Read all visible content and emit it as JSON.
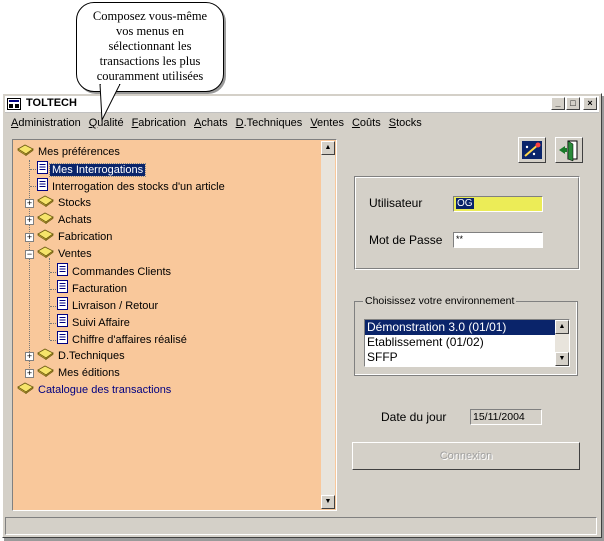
{
  "callout": {
    "text": "Composez vous-même vos menus en sélectionnant les transactions les plus couramment utilisées"
  },
  "window": {
    "title": "TOLTECH",
    "controls": {
      "minimize": "_",
      "maximize": "□",
      "close": "×"
    }
  },
  "menubar": [
    {
      "label": "Administration",
      "underline": "A",
      "rest": "dministration"
    },
    {
      "label": "Qualité",
      "underline": "Q",
      "rest": "ualité"
    },
    {
      "label": "Fabrication",
      "underline": "F",
      "rest": "abrication"
    },
    {
      "label": "Achats",
      "underline": "A",
      "rest": "chats"
    },
    {
      "label": "D.Techniques",
      "underline": "D",
      "rest": ".Techniques"
    },
    {
      "label": "Ventes",
      "underline": "V",
      "rest": "entes"
    },
    {
      "label": "Coûts",
      "underline": "C",
      "rest": "oûts"
    },
    {
      "label": "Stocks",
      "underline": "S",
      "rest": "tocks"
    }
  ],
  "tree": {
    "items": [
      {
        "label": "Mes préférences",
        "type": "book",
        "expander": ""
      },
      {
        "label": "Mes Interrogations",
        "type": "doc",
        "selected": true
      },
      {
        "label": "Interrogation des stocks d'un article",
        "type": "doc"
      },
      {
        "label": "Stocks",
        "type": "book",
        "expander": "+"
      },
      {
        "label": "Achats",
        "type": "book",
        "expander": "+"
      },
      {
        "label": "Fabrication",
        "type": "book",
        "expander": "+"
      },
      {
        "label": "Ventes",
        "type": "book",
        "expander": "−"
      },
      {
        "label": "Commandes Clients",
        "type": "doc"
      },
      {
        "label": "Facturation",
        "type": "doc"
      },
      {
        "label": "Livraison / Retour",
        "type": "doc"
      },
      {
        "label": "Suivi Affaire",
        "type": "doc"
      },
      {
        "label": "Chiffre d'affaires réalisé",
        "type": "doc"
      },
      {
        "label": "D.Techniques",
        "type": "book",
        "expander": "+"
      },
      {
        "label": "Mes éditions",
        "type": "book",
        "expander": "+"
      },
      {
        "label": "Catalogue des transactions",
        "type": "book",
        "expander": ""
      }
    ]
  },
  "login": {
    "user_label": "Utilisateur",
    "user_value": "OG",
    "password_label": "Mot de Passe",
    "password_value": "**"
  },
  "environment": {
    "legend": "Choisissez votre environnement",
    "options": [
      "Démonstration 3.0 (01/01)",
      "Etablissement (01/02)",
      "SFFP"
    ],
    "selected": "Démonstration 3.0 (01/01)"
  },
  "date": {
    "label": "Date du jour",
    "value": "15/11/2004"
  },
  "connect_label": "Connexion",
  "colors": {
    "tree_bg": "#f9c89b",
    "selection": "#0a246a",
    "user_field": "#ecec57",
    "window": "#d4d0c8"
  }
}
